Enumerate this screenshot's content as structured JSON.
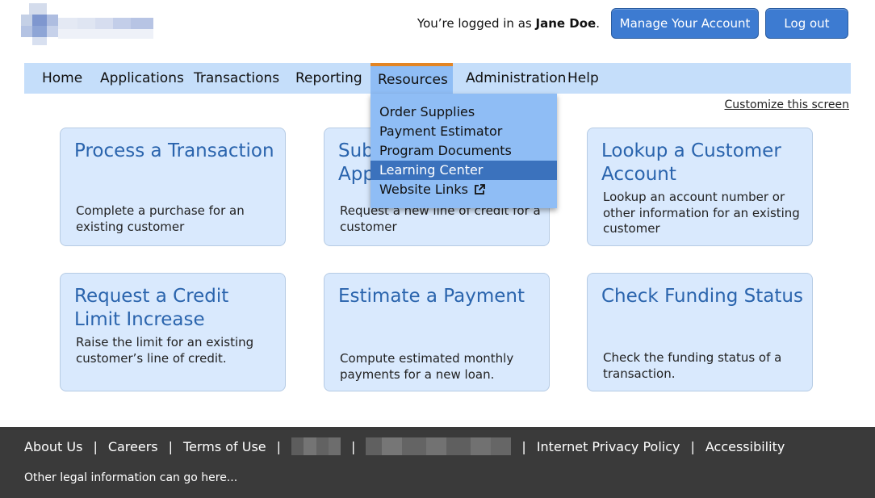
{
  "header": {
    "logged_in_prefix": "You’re logged in as",
    "user_name": "Jane Doe",
    "user_suffix": ".",
    "manage_account_label": "Manage Your Account",
    "logout_label": "Log out"
  },
  "nav": {
    "items": [
      {
        "label": "Home"
      },
      {
        "label": "Applications"
      },
      {
        "label": "Transactions"
      },
      {
        "label": "Reporting"
      },
      {
        "label": "Resources"
      },
      {
        "label": "Administration"
      },
      {
        "label": "Help"
      }
    ],
    "active": "Resources"
  },
  "customize_label": "Customize this screen",
  "resources_menu": {
    "items": [
      {
        "label": "Order Supplies"
      },
      {
        "label": "Payment Estimator"
      },
      {
        "label": "Program Documents"
      },
      {
        "label": "Learning Center"
      },
      {
        "label": "Website Links"
      }
    ],
    "highlighted": "Learning Center",
    "external_icon": "external-link-icon"
  },
  "cards": [
    {
      "title": "Process a Transaction",
      "desc": "Complete a purchase for an existing customer"
    },
    {
      "title": "Submit an Application",
      "desc": "Request a new line of credit for a customer"
    },
    {
      "title": "Lookup a Customer Account",
      "desc": "Lookup an account number or other information for an existing customer"
    },
    {
      "title": "Request a Credit Limit Increase",
      "desc": "Raise the limit for an existing customer’s line of credit."
    },
    {
      "title": "Estimate a Payment",
      "desc": "Compute estimated monthly payments for a new loan."
    },
    {
      "title": "Check Funding Status",
      "desc": "Check the funding status of a transaction."
    }
  ],
  "footer": {
    "links": [
      {
        "label": "About Us"
      },
      {
        "label": "Careers"
      },
      {
        "label": "Terms of Use"
      },
      {
        "label": "Internet Privacy Policy"
      },
      {
        "label": "Accessibility"
      }
    ],
    "legal": "Other legal information can go here..."
  },
  "colors": {
    "accent": "#3d7bd1",
    "nav_bg": "#c5defa",
    "nav_active": "#8fbdf5",
    "nav_active_border": "#e38524",
    "card_bg": "#d9e9fd",
    "card_title": "#2a64ad",
    "footer_bg": "#3a3a3a"
  }
}
